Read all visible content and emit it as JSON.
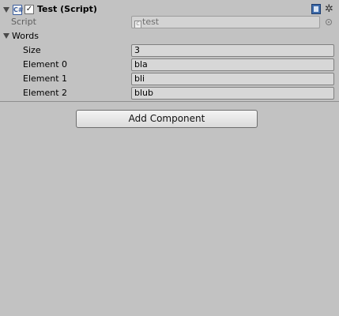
{
  "component": {
    "title": "Test (Script)",
    "enabled_checkmark": "✓",
    "icon_glyph": "C#",
    "gear_glyph": "✲"
  },
  "script_field": {
    "label": "Script",
    "value": "test",
    "mini_icon_glyph": "C"
  },
  "words": {
    "label": "Words",
    "size_label": "Size",
    "size_value": "3",
    "elements": [
      {
        "label": "Element 0",
        "value": "bla"
      },
      {
        "label": "Element 1",
        "value": "bli"
      },
      {
        "label": "Element 2",
        "value": "blub"
      }
    ]
  },
  "add_component_label": "Add Component",
  "icons": {
    "header_foldout": "foldout-arrow",
    "script": "csharp-script-icon",
    "help": "help-book-icon",
    "settings": "gear-icon",
    "object_picker": "target-icon"
  },
  "colors": {
    "background": "#c2c2c2",
    "field": "#d7d7d7",
    "book_icon": "#3f6cab"
  }
}
